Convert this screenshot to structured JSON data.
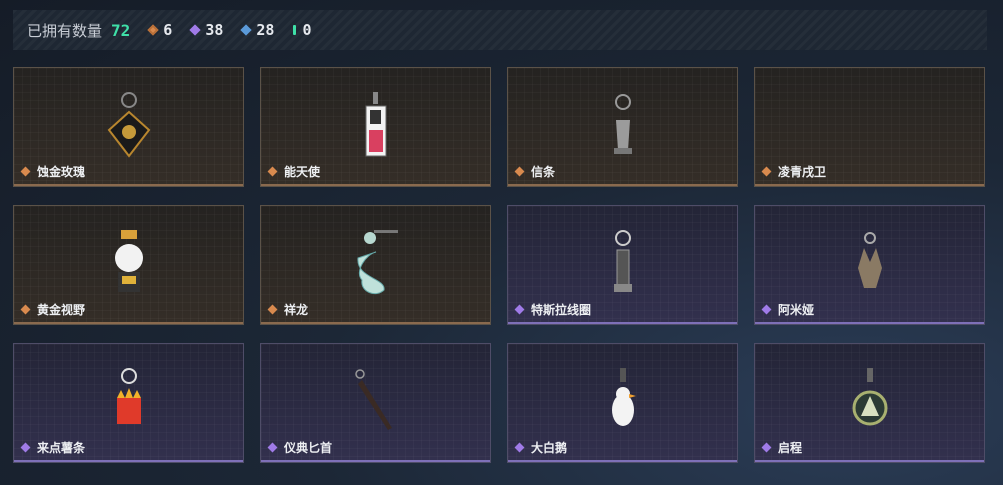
{
  "header": {
    "owned_label": "已拥有数量",
    "owned_count": "72",
    "stats": [
      {
        "icon": "orange-gem-icon",
        "value": "6"
      },
      {
        "icon": "purple-gem-icon",
        "value": "38"
      },
      {
        "icon": "blue-gem-icon",
        "value": "28"
      },
      {
        "icon": "teal-gem-icon",
        "value": "0"
      }
    ]
  },
  "items": [
    {
      "name": "蚀金玫瑰",
      "rarity": "orange",
      "icon": "rose-pendant-icon"
    },
    {
      "name": "能天使",
      "rarity": "orange",
      "icon": "card-pendant-icon"
    },
    {
      "name": "信条",
      "rarity": "orange",
      "icon": "hand-pendant-icon"
    },
    {
      "name": "凌青戌卫",
      "rarity": "orange",
      "icon": "empty-pendant-icon"
    },
    {
      "name": "黄金视野",
      "rarity": "orange",
      "icon": "chibi-pendant-icon"
    },
    {
      "name": "祥龙",
      "rarity": "orange",
      "icon": "dragon-pendant-icon"
    },
    {
      "name": "特斯拉线圈",
      "rarity": "purple",
      "icon": "coil-pendant-icon"
    },
    {
      "name": "阿米娅",
      "rarity": "purple",
      "icon": "amiya-pendant-icon"
    },
    {
      "name": "来点薯条",
      "rarity": "purple",
      "icon": "fries-pendant-icon"
    },
    {
      "name": "仪典匕首",
      "rarity": "purple",
      "icon": "dagger-pendant-icon"
    },
    {
      "name": "大白鹅",
      "rarity": "purple",
      "icon": "goose-pendant-icon"
    },
    {
      "name": "启程",
      "rarity": "purple",
      "icon": "ring-pendant-icon"
    }
  ],
  "colors": {
    "owned_count": "#3fe0a8",
    "orange_rarity": "#d98a4e",
    "purple_rarity": "#a07be8",
    "blue_rarity": "#5b9ad9"
  }
}
